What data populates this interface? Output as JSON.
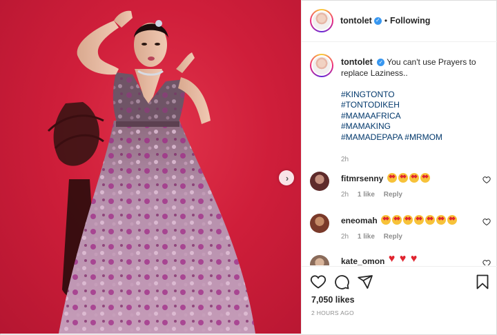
{
  "post": {
    "username": "tontolet",
    "follow_state": "Following",
    "separator": "•",
    "caption": "You can't use Prayers to replace Laziness..",
    "hashtags": [
      "#KINGTONTO",
      "#TONTODIKEH",
      "#MAMAAFRICA",
      "#MAMAKING",
      "#MAMADEPAPA",
      "#MRMOM"
    ],
    "caption_time": "2h",
    "likes": "7,050 likes",
    "posted_ago": "2 HOURS AGO"
  },
  "comments": [
    {
      "username": "fitmrsenny",
      "emojis": [
        "star",
        "star",
        "star",
        "star"
      ],
      "time": "2h",
      "likes": "1 like",
      "reply": "Reply"
    },
    {
      "username": "eneomah",
      "emojis": [
        "star",
        "star",
        "star",
        "star",
        "star",
        "star",
        "star"
      ],
      "time": "2h",
      "likes": "1 like",
      "reply": "Reply"
    },
    {
      "username": "kate_omon",
      "emojis": [
        "heart",
        "heart",
        "heart"
      ]
    }
  ],
  "icons": {
    "verified": "verified-badge-icon",
    "next": "chevron-right-icon",
    "like": "heart-outline-icon",
    "comment": "comment-bubble-icon",
    "share": "paper-plane-icon",
    "save": "bookmark-icon"
  },
  "colors": {
    "background_photo": "#cf1e3a",
    "hashtag": "#00376b",
    "verified": "#3897f0",
    "muted": "#8e8e8e"
  }
}
